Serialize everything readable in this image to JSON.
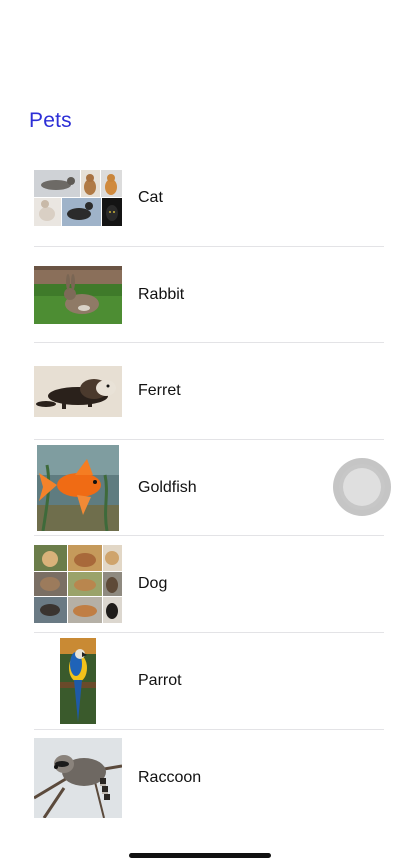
{
  "header": {
    "title": "Pets"
  },
  "pets": [
    {
      "label": "Cat",
      "image": "cat-collage-photo"
    },
    {
      "label": "Rabbit",
      "image": "rabbit-photo"
    },
    {
      "label": "Ferret",
      "image": "ferret-photo"
    },
    {
      "label": "Goldfish",
      "image": "goldfish-photo"
    },
    {
      "label": "Dog",
      "image": "dog-collage-photo"
    },
    {
      "label": "Parrot",
      "image": "parrot-photo"
    },
    {
      "label": "Raccoon",
      "image": "raccoon-photo"
    }
  ],
  "colors": {
    "title": "#2d2fd6",
    "separator": "#e3e3e6",
    "text": "#111111"
  }
}
